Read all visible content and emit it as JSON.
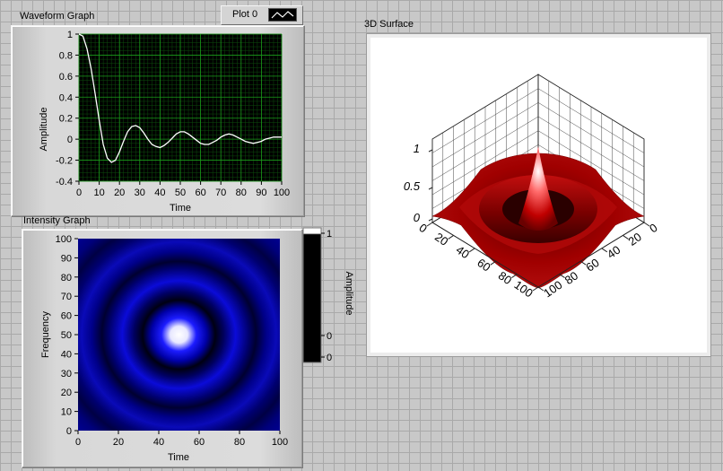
{
  "waveform": {
    "caption": "Waveform Graph",
    "legend_label": "Plot 0",
    "xlabel": "Time",
    "ylabel": "Amplitude",
    "x_ticks": [
      "0",
      "10",
      "20",
      "30",
      "40",
      "50",
      "60",
      "70",
      "80",
      "90",
      "100"
    ],
    "y_ticks": [
      "1",
      "0.8",
      "0.6",
      "0.4",
      "0.2",
      "0",
      "-0.2",
      "-0.4"
    ]
  },
  "intensity": {
    "caption": "Intensity Graph",
    "xlabel": "Time",
    "ylabel": "Frequency",
    "x_ticks": [
      "0",
      "20",
      "40",
      "60",
      "80",
      "100"
    ],
    "y_ticks": [
      "100",
      "90",
      "80",
      "70",
      "60",
      "50",
      "40",
      "30",
      "20",
      "10",
      "0"
    ],
    "scale_label": "Amplitude",
    "scale_ticks": [
      "1",
      "0",
      "0"
    ]
  },
  "surface": {
    "caption": "3D Surface",
    "z_ticks": [
      "1",
      "0.5",
      "0"
    ],
    "x_ticks": [
      "0",
      "20",
      "40",
      "60",
      "80",
      "100"
    ],
    "y_ticks": [
      "0",
      "20",
      "40",
      "60",
      "80",
      "100"
    ]
  },
  "colors": {
    "plot_bg": "#000000",
    "grid": "#1a9a1a",
    "trace": "#ffffff",
    "surface": "#b00000",
    "intensity_low": "#000000",
    "intensity_mid": "#1a1aff",
    "intensity_high": "#ffffff"
  },
  "chart_data": [
    {
      "type": "line",
      "x": [
        0,
        2,
        4,
        6,
        8,
        10,
        12,
        14,
        16,
        18,
        20,
        22,
        24,
        26,
        28,
        30,
        32,
        34,
        36,
        38,
        40,
        42,
        44,
        46,
        48,
        50,
        52,
        54,
        56,
        58,
        60,
        62,
        64,
        66,
        68,
        70,
        72,
        74,
        76,
        78,
        80,
        82,
        84,
        86,
        88,
        90,
        92,
        94,
        96,
        98,
        100
      ],
      "y": [
        1.0,
        0.98,
        0.86,
        0.67,
        0.43,
        0.18,
        -0.05,
        -0.18,
        -0.22,
        -0.2,
        -0.12,
        -0.02,
        0.07,
        0.12,
        0.13,
        0.11,
        0.06,
        0.0,
        -0.05,
        -0.07,
        -0.08,
        -0.06,
        -0.03,
        0.01,
        0.05,
        0.07,
        0.07,
        0.05,
        0.02,
        -0.01,
        -0.04,
        -0.05,
        -0.05,
        -0.03,
        -0.01,
        0.02,
        0.04,
        0.05,
        0.04,
        0.02,
        0.0,
        -0.02,
        -0.03,
        -0.04,
        -0.03,
        -0.02,
        0.0,
        0.01,
        0.02,
        0.02,
        0.02
      ],
      "xlabel": "Time",
      "ylabel": "Amplitude",
      "xlim": [
        0,
        100
      ],
      "ylim": [
        -0.4,
        1
      ],
      "grid": true,
      "legend": "top-right",
      "series_name": "Plot 0"
    },
    {
      "type": "heatmap",
      "xlabel": "Time",
      "ylabel": "Frequency",
      "xlim": [
        0,
        100
      ],
      "ylim": [
        0,
        100
      ],
      "center": [
        50,
        50
      ],
      "colorbar_label": "Amplitude",
      "colorbar_range": [
        0,
        1
      ]
    },
    {
      "type": "area",
      "x_range": [
        0,
        100
      ],
      "y_range": [
        0,
        100
      ],
      "z_range": [
        0,
        1
      ],
      "peak": [
        50,
        50,
        1
      ]
    }
  ]
}
